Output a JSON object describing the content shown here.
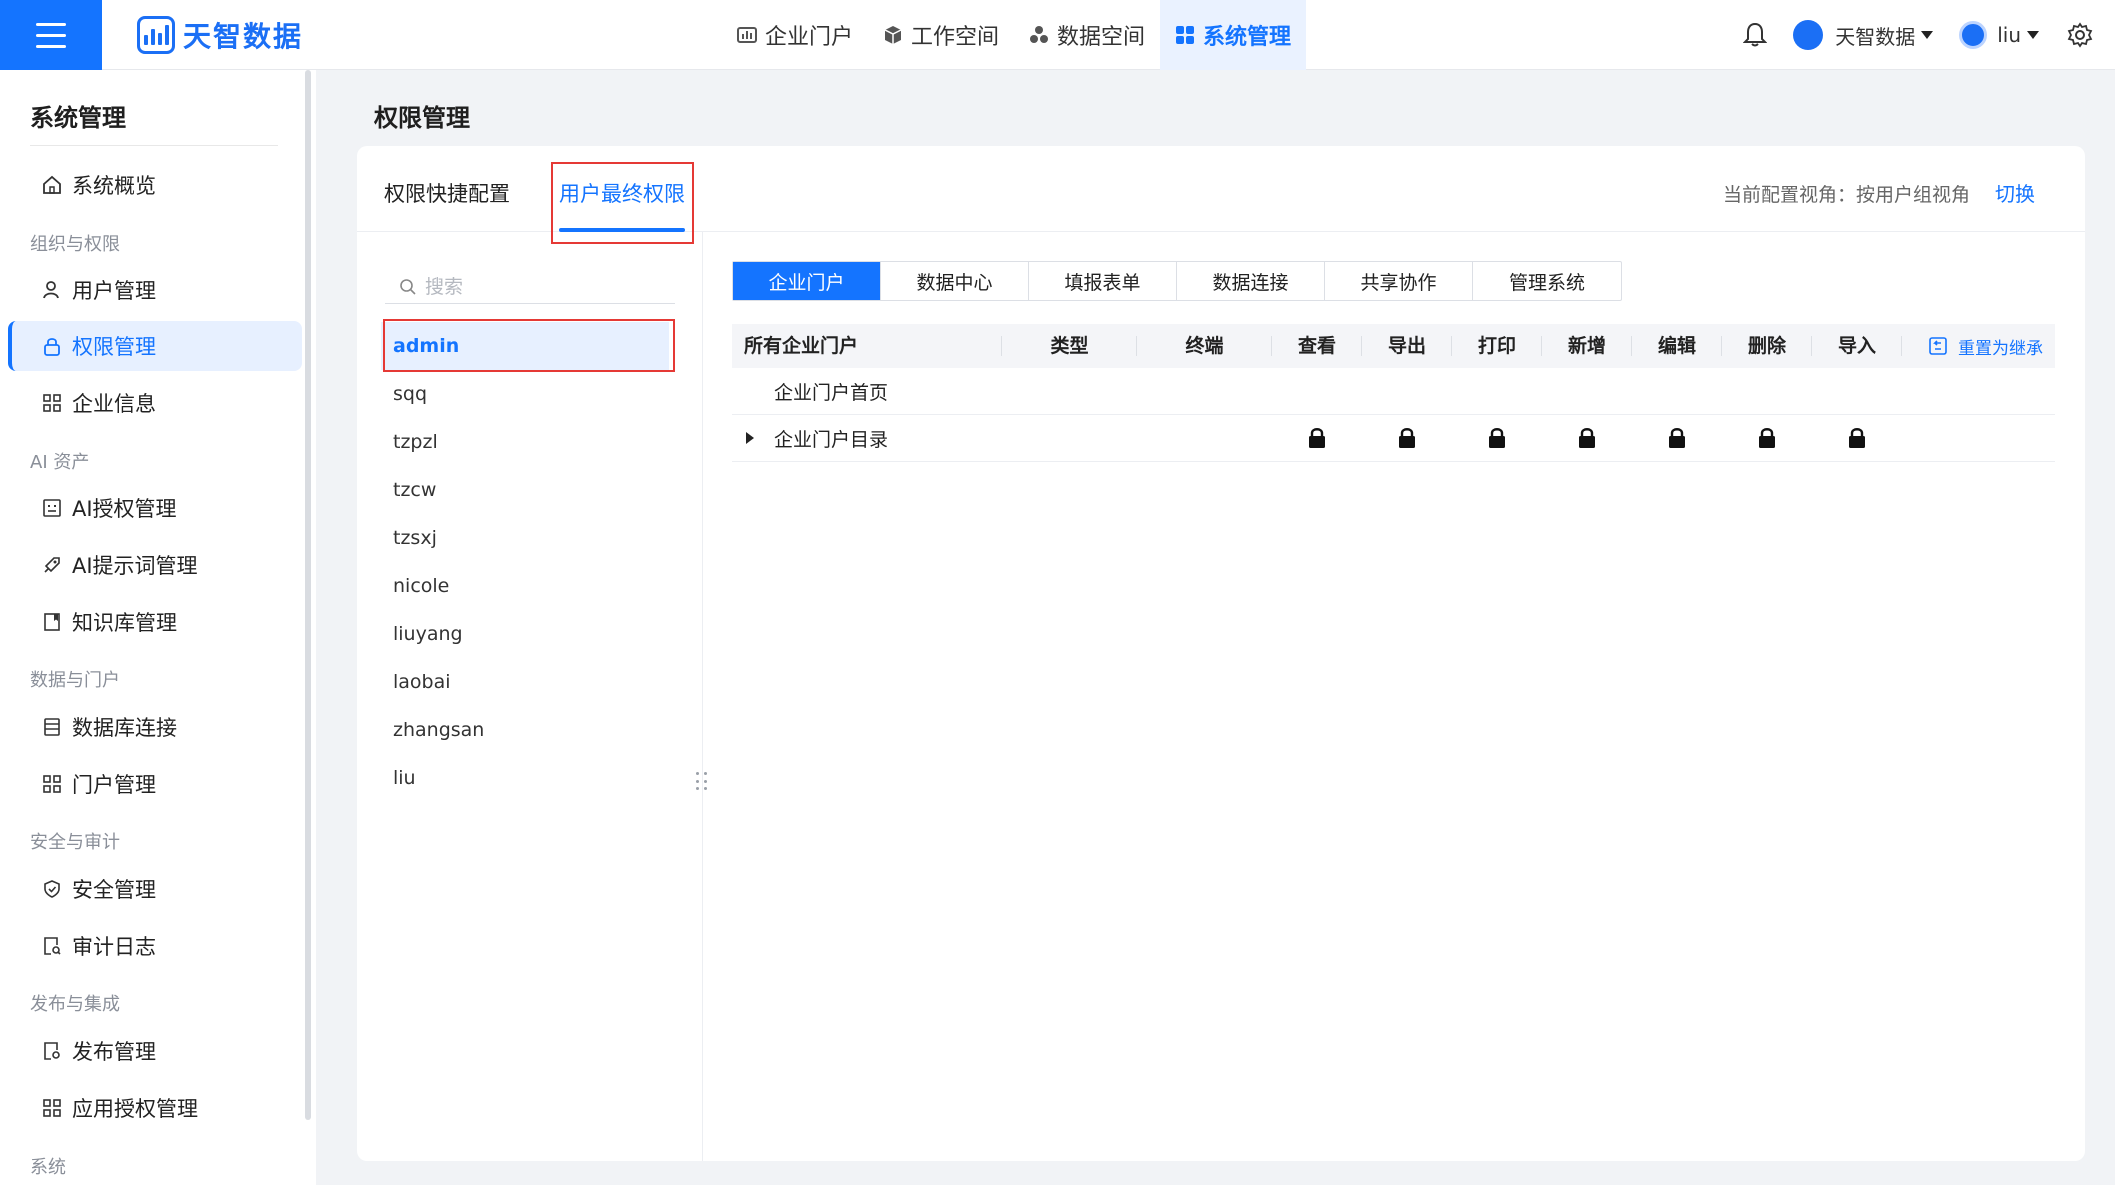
{
  "app": {
    "logo_text": "天智数据"
  },
  "topnav": [
    {
      "label": "企业门户",
      "icon": "chart-icon"
    },
    {
      "label": "工作空间",
      "icon": "cube-icon"
    },
    {
      "label": "数据空间",
      "icon": "cluster-icon"
    },
    {
      "label": "系统管理",
      "icon": "grid-icon",
      "active": true
    }
  ],
  "header": {
    "org_name": "天智数据",
    "user_name": "liu"
  },
  "sidebar": {
    "title": "系统管理",
    "overview": "系统概览",
    "groups": {
      "org": "组织与权限",
      "ai": "AI 资产",
      "data": "数据与门户",
      "security": "安全与审计",
      "publish": "发布与集成",
      "system": "系统"
    },
    "items": {
      "user_mgmt": "用户管理",
      "perm_mgmt": "权限管理",
      "company_info": "企业信息",
      "ai_auth": "AI授权管理",
      "ai_prompt": "AI提示词管理",
      "kb": "知识库管理",
      "db_conn": "数据库连接",
      "portal_mgmt": "门户管理",
      "security_mgmt": "安全管理",
      "audit_log": "审计日志",
      "publish_mgmt": "发布管理",
      "app_auth": "应用授权管理"
    }
  },
  "page": {
    "title": "权限管理",
    "tabs": {
      "quick": "权限快捷配置",
      "final": "用户最终权限"
    },
    "view_note": "当前配置视角：按用户组视角",
    "switch_label": "切换"
  },
  "users": {
    "search_placeholder": "搜索",
    "list": [
      "admin",
      "sqq",
      "tzpzl",
      "tzcw",
      "tzsxj",
      "nicole",
      "liuyang",
      "laobai",
      "zhangsan",
      "liu"
    ],
    "selected": "admin"
  },
  "categories": [
    "企业门户",
    "数据中心",
    "填报表单",
    "数据连接",
    "共享协作",
    "管理系统"
  ],
  "table": {
    "headers": {
      "name": "所有企业门户",
      "type": "类型",
      "terminal": "终端",
      "view": "查看",
      "export": "导出",
      "print": "打印",
      "add": "新增",
      "edit": "编辑",
      "delete": "删除",
      "import": "导入"
    },
    "reset_label": "重置为继承",
    "rows": [
      {
        "name": "企业门户首页",
        "expandable": false,
        "locked": []
      },
      {
        "name": "企业门户目录",
        "expandable": true,
        "locked": [
          "查看",
          "导出",
          "打印",
          "新增",
          "编辑",
          "删除",
          "导入"
        ]
      }
    ]
  },
  "colors": {
    "accent": "#1474ff",
    "highlight": "#e53935"
  }
}
